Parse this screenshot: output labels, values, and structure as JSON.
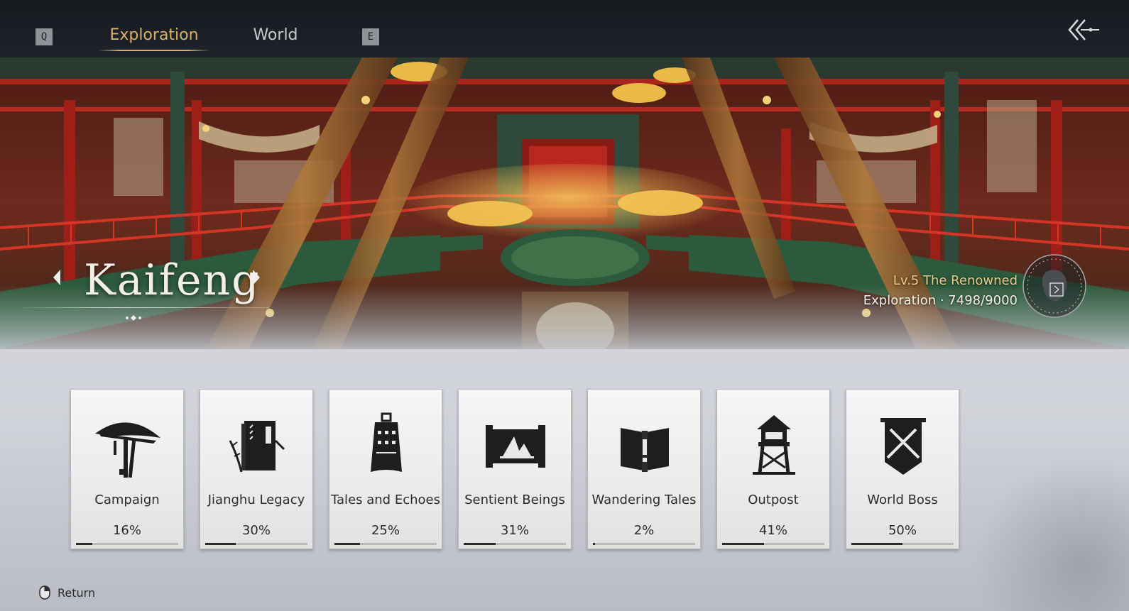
{
  "header": {
    "key_prev": "Q",
    "key_next": "E",
    "tabs": [
      {
        "label": "Exploration",
        "active": true
      },
      {
        "label": "World",
        "active": false
      }
    ],
    "back_icon": "double-chevron-back-icon"
  },
  "banner": {
    "region_name": "Kaifeng",
    "renown_level": "Lv.5 The Renowned",
    "exploration_progress": "Exploration · 7498/9000",
    "emblem_icon": "region-emblem-icon"
  },
  "categories": [
    {
      "label": "Campaign",
      "percent_text": "16%",
      "progress": 0.16,
      "icon": "straw-hat-swords-icon"
    },
    {
      "label": "Jianghu Legacy",
      "percent_text": "30%",
      "progress": 0.3,
      "icon": "book-bamboo-icon"
    },
    {
      "label": "Tales and Echoes",
      "percent_text": "25%",
      "progress": 0.25,
      "icon": "bell-icon"
    },
    {
      "label": "Sentient Beings",
      "percent_text": "31%",
      "progress": 0.31,
      "icon": "scroll-painting-icon"
    },
    {
      "label": "Wandering Tales",
      "percent_text": "2%",
      "progress": 0.02,
      "icon": "open-book-exclamation-icon"
    },
    {
      "label": "Outpost",
      "percent_text": "41%",
      "progress": 0.41,
      "icon": "watchtower-icon"
    },
    {
      "label": "World Boss",
      "percent_text": "50%",
      "progress": 0.5,
      "icon": "crossed-swords-banner-icon"
    }
  ],
  "footer": {
    "return_label": "Return",
    "return_icon": "mouse-right-click-icon"
  },
  "colors": {
    "accent_gold": "#d9b06a",
    "topbar": "#1a1f24",
    "card_bg": "#f0f0ef",
    "progress_fill": "#2b2b2b"
  }
}
